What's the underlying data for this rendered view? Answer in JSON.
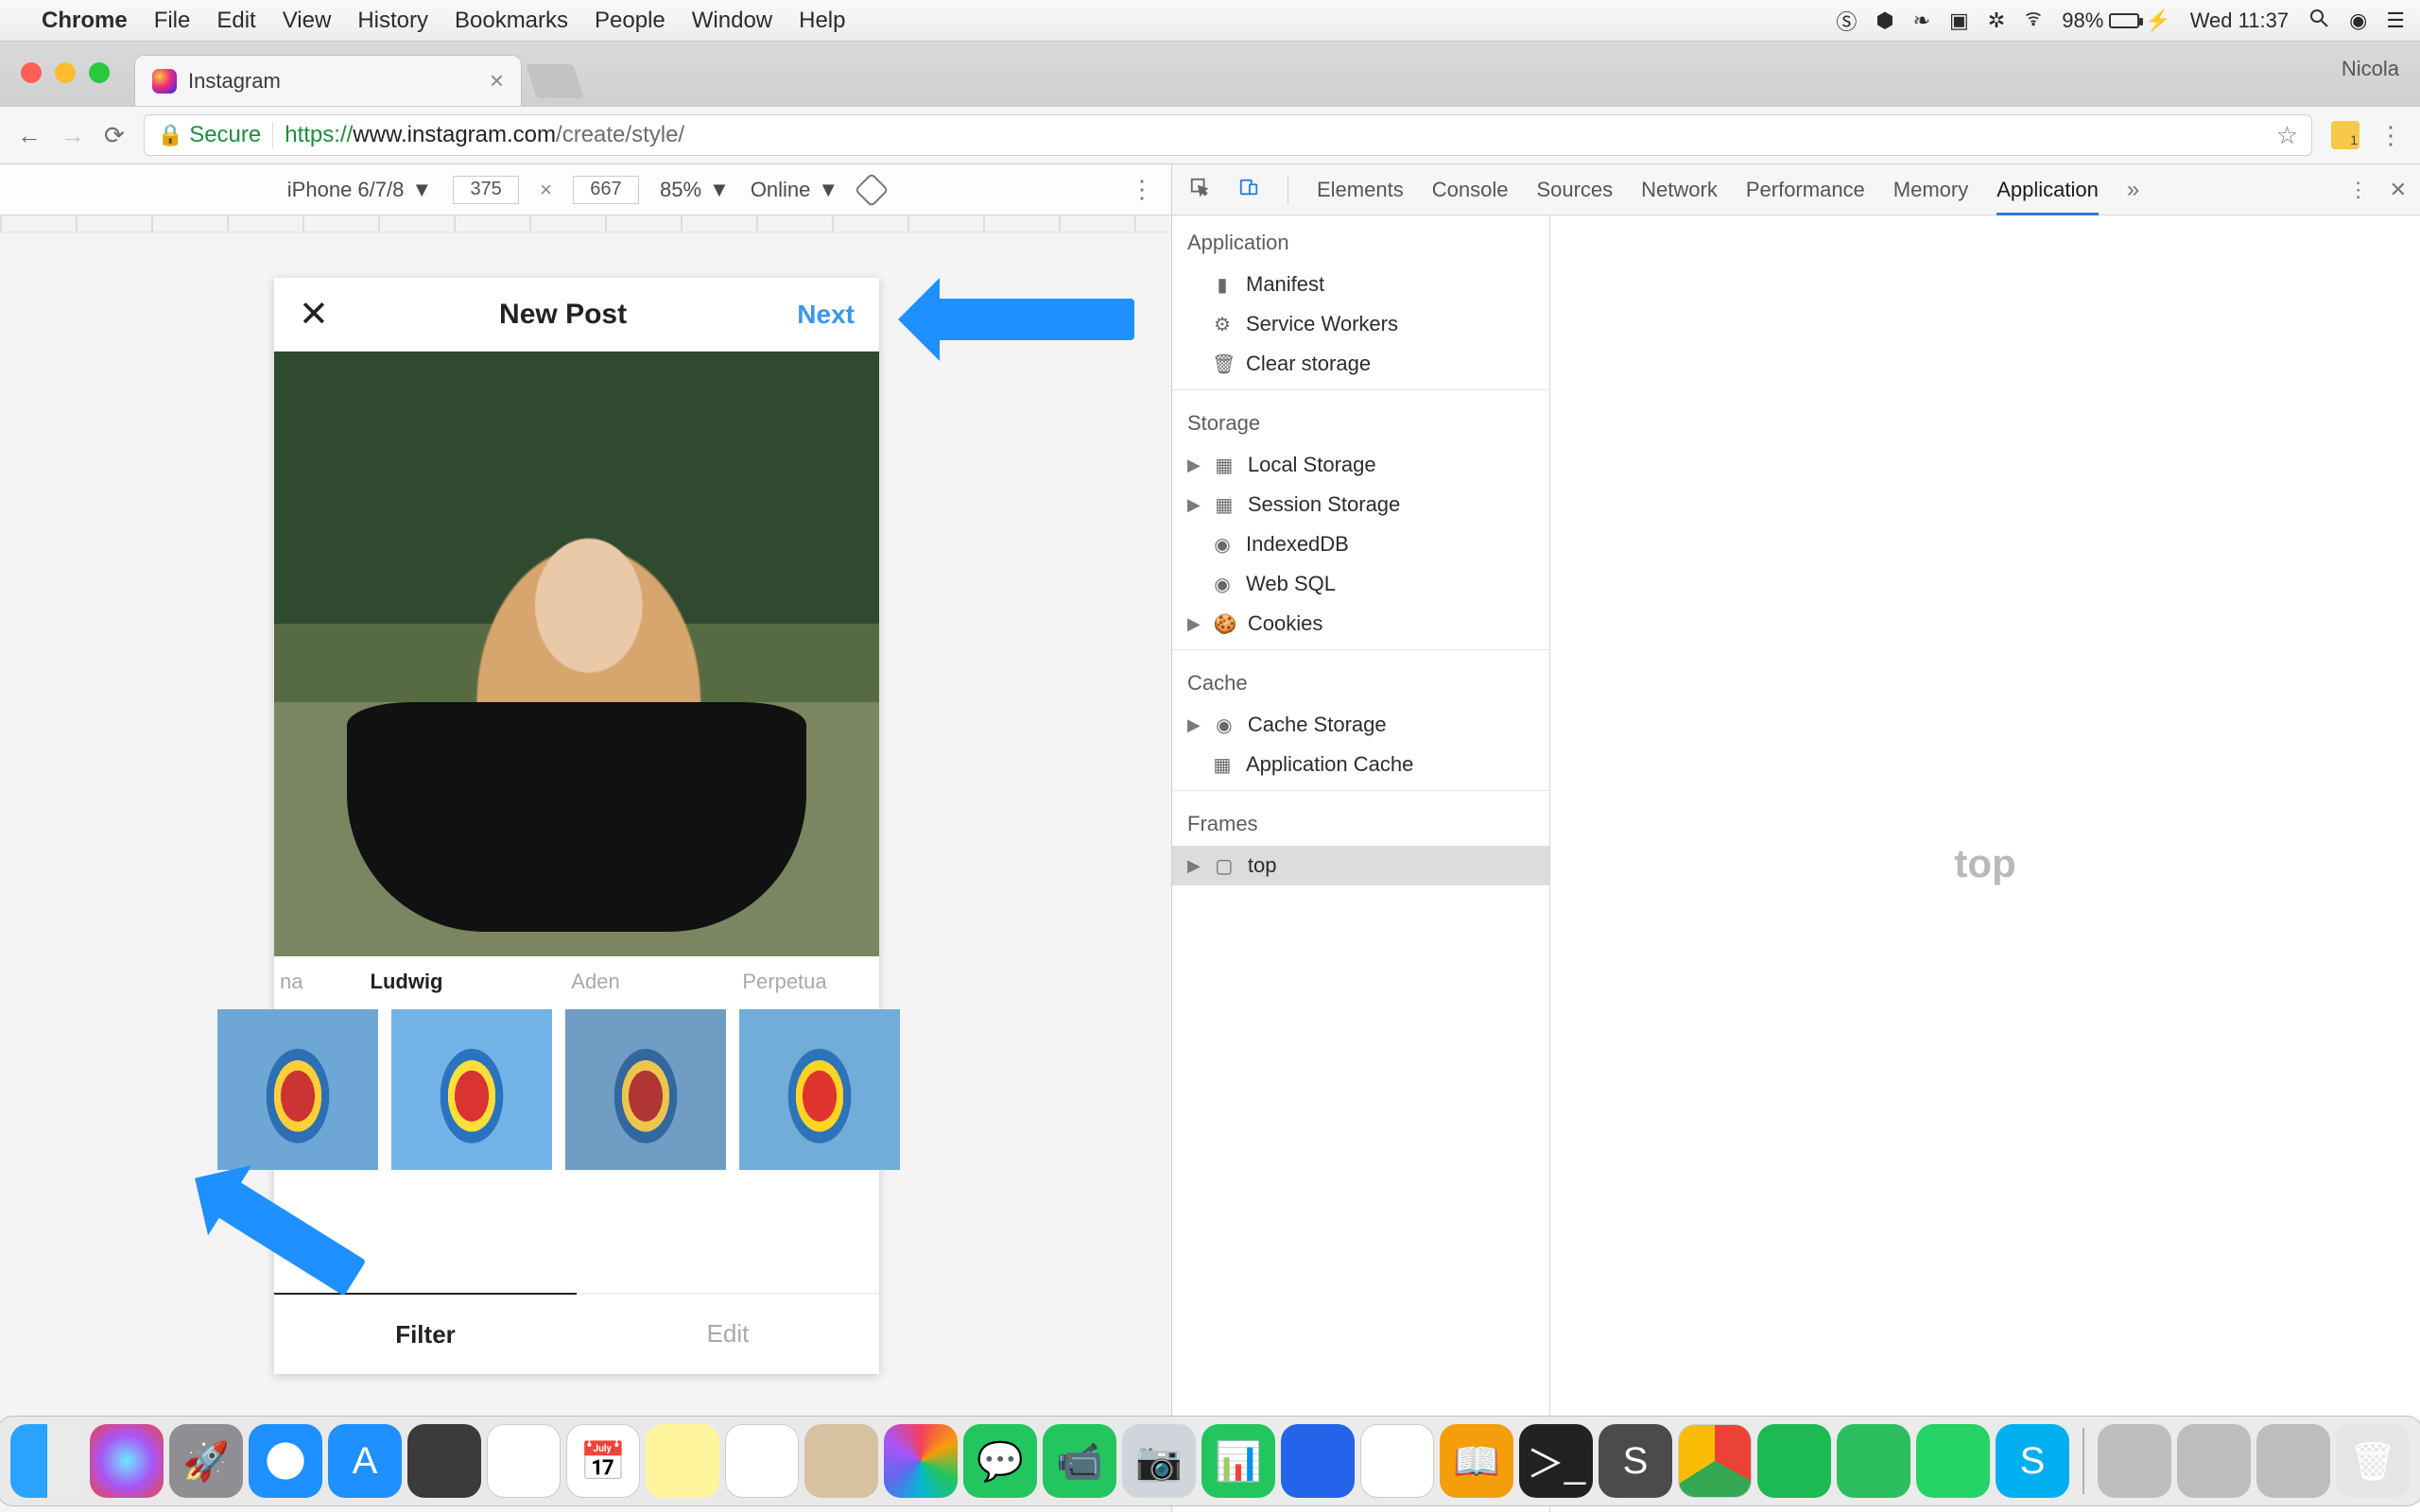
{
  "menubar": {
    "app_name": "Chrome",
    "items": [
      "File",
      "Edit",
      "View",
      "History",
      "Bookmarks",
      "People",
      "Window",
      "Help"
    ],
    "status": {
      "battery_percent": "98%",
      "clock": "Wed 11:37"
    }
  },
  "chrome": {
    "tab_title": "Instagram",
    "profile_name": "Nicola",
    "secure_label": "Secure",
    "url_scheme": "https://",
    "url_host": "www.instagram.com",
    "url_path": "/create/style/",
    "ext_badge_count": "1"
  },
  "device_toolbar": {
    "device": "iPhone 6/7/8",
    "width": "375",
    "height": "667",
    "zoom": "85%",
    "throttle": "Online"
  },
  "instagram": {
    "header_title": "New Post",
    "next_label": "Next",
    "filters": [
      {
        "name_fragment": "na",
        "active": false
      },
      {
        "name": "Ludwig",
        "active": true
      },
      {
        "name": "Aden",
        "active": false
      },
      {
        "name": "Perpetua",
        "active": false
      }
    ],
    "bottom_tabs": {
      "filter": "Filter",
      "edit": "Edit",
      "active": "filter"
    }
  },
  "devtools": {
    "tabs": [
      "Elements",
      "Console",
      "Sources",
      "Network",
      "Performance",
      "Memory",
      "Application"
    ],
    "active_tab": "Application",
    "sidebar": {
      "application": {
        "title": "Application",
        "items": [
          "Manifest",
          "Service Workers",
          "Clear storage"
        ]
      },
      "storage": {
        "title": "Storage",
        "items": [
          "Local Storage",
          "Session Storage",
          "IndexedDB",
          "Web SQL",
          "Cookies"
        ]
      },
      "cache": {
        "title": "Cache",
        "items": [
          "Cache Storage",
          "Application Cache"
        ]
      },
      "frames": {
        "title": "Frames",
        "items": [
          "top"
        ]
      }
    },
    "main_placeholder": "top"
  },
  "dock": {
    "items": [
      "finder",
      "siri",
      "launchpad",
      "safari",
      "appstore",
      "mission",
      "maps",
      "calendar",
      "notes",
      "reminders",
      "contacts",
      "photos",
      "messages",
      "facetime",
      "photobooth",
      "numbers",
      "keynote",
      "itunes",
      "ibooks",
      "terminal",
      "sublime",
      "chrome",
      "spotify",
      "evernote",
      "whatsapp",
      "skype"
    ],
    "right_items": [
      "window-preview-1",
      "window-preview-2",
      "document",
      "trash"
    ]
  }
}
